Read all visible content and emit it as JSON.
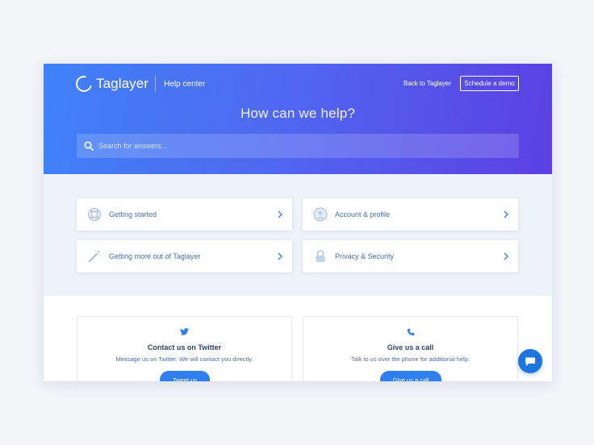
{
  "brand": {
    "name": "Taglayer",
    "section": "Help center"
  },
  "nav": {
    "back_label": "Back to Taglayer",
    "demo_label": "Schedule a demo"
  },
  "hero": {
    "title": "How can we help?",
    "search_placeholder": "Search for answers..."
  },
  "categories": [
    {
      "label": "Getting started",
      "icon": "lifebuoy-icon"
    },
    {
      "label": "Account & profile",
      "icon": "user-icon"
    },
    {
      "label": "Getting more out of Taglayer",
      "icon": "magic-wand-icon"
    },
    {
      "label": "Privacy & Security",
      "icon": "lock-icon"
    }
  ],
  "contact": [
    {
      "title": "Contact us on Twitter",
      "description": "Message us on Twitter. We will contact you directly.",
      "button": "Tweet us",
      "icon": "twitter-icon"
    },
    {
      "title": "Give us a call",
      "description": "Talk to us over the phone for additional help.",
      "button": "Give us a call",
      "icon": "phone-icon"
    }
  ],
  "colors": {
    "gradient_start": "#3f82f7",
    "gradient_end": "#5c3fe3",
    "accent": "#2f7ff0",
    "text_link": "#4a6fa8",
    "chat": "#1d75e0"
  }
}
